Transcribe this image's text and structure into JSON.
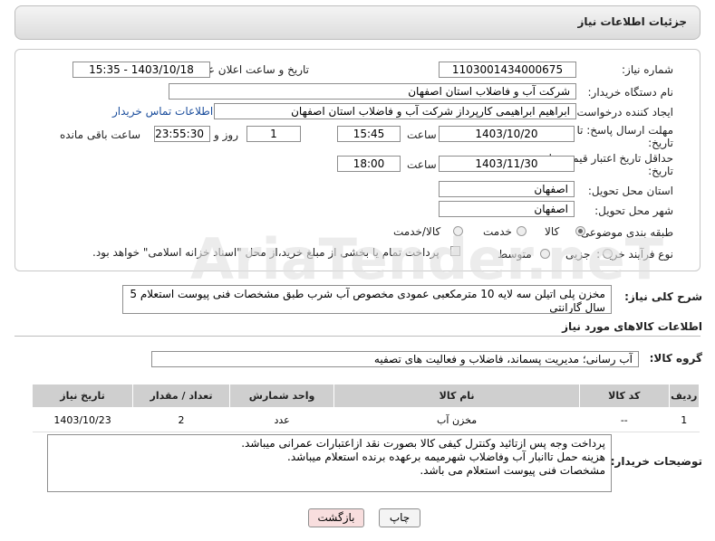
{
  "header": {
    "title": "جزئیات اطلاعات نیاز"
  },
  "fields": {
    "need_number": {
      "label": "شماره نیاز:",
      "value": "1103001434000675"
    },
    "announce_datetime": {
      "label": "تاریخ و ساعت اعلان عمومی:",
      "value": "1403/10/18 - 15:35"
    },
    "buyer_org": {
      "label": "نام دستگاه خریدار:",
      "value": "شرکت آب و فاضلاب استان اصفهان"
    },
    "requester": {
      "label": "ایجاد کننده درخواست:",
      "value": "ابراهیم ابراهیمی کارپرداز شرکت آب و فاضلاب استان اصفهان",
      "link": "اطلاعات تماس خریدار"
    },
    "reply_deadline": {
      "label_line1": "مهلت ارسال پاسخ: تا",
      "label_line2": "تاریخ:",
      "date": "1403/10/20",
      "time_label": "ساعت",
      "time": "15:45",
      "days": "1",
      "days_label": "روز و",
      "remaining": "23:55:30",
      "remaining_label": "ساعت باقی مانده"
    },
    "price_validity": {
      "label_line1": "حداقل تاریخ اعتبار قیمت: تا",
      "label_line2": "تاریخ:",
      "date": "1403/11/30",
      "time_label": "ساعت",
      "time": "18:00"
    },
    "province": {
      "label": "استان محل تحویل:",
      "value": "اصفهان"
    },
    "city": {
      "label": "شهر محل تحویل:",
      "value": "اصفهان"
    },
    "category": {
      "label": "طبقه بندی موضوعی:",
      "options": [
        "کالا",
        "خدمت",
        "کالا/خدمت"
      ]
    },
    "purchase_type": {
      "label": "نوع فرآیند خرید :",
      "options": [
        "جزیی",
        "متوسط"
      ],
      "payment_note": "پرداخت تمام یا بخشی از مبلغ خرید،از محل \"اسناد خزانه اسلامی\" خواهد بود."
    }
  },
  "summary": {
    "label": "شرح کلی نیاز:",
    "text": "مخزن پلی اتیلن سه لایه 10 مترمکعبی عمودی مخصوص آب شرب طبق مشخصات فنی پیوست استعلام 5 سال گارانتی"
  },
  "goods_section": {
    "title": "اطلاعات کالاهای مورد نیاز"
  },
  "goods_group": {
    "label": "گروه کالا:",
    "value": "آب رسانی؛ مدیریت پسماند، فاضلاب و فعالیت های تصفیه"
  },
  "table": {
    "headers": [
      "ردیف",
      "کد کالا",
      "نام کالا",
      "واحد شمارش",
      "تعداد / مقدار",
      "تاریخ نیاز"
    ],
    "rows": [
      [
        "1",
        "--",
        "مخزن آب",
        "عدد",
        "2",
        "1403/10/23"
      ]
    ]
  },
  "buyer_notes": {
    "label": "توضیحات خریدار:",
    "lines": [
      "پرداخت وجه پس ازتائید وکنترل کیفی کالا بصورت نقد ازاعتبارات عمرانی میباشد.",
      "هزینه حمل تاانبار آب وفاضلاب شهرمیمه برعهده برنده استعلام میباشد.",
      "مشخصات فنی پیوست استعلام می باشد."
    ]
  },
  "buttons": {
    "print": "چاپ",
    "back": "بازگشت"
  },
  "colors": {
    "back_button_bg": "#f8dede",
    "header_gradient_top": "#f4f4f4",
    "table_header_bg": "#cfcfcf",
    "link": "#1a4d9c"
  }
}
